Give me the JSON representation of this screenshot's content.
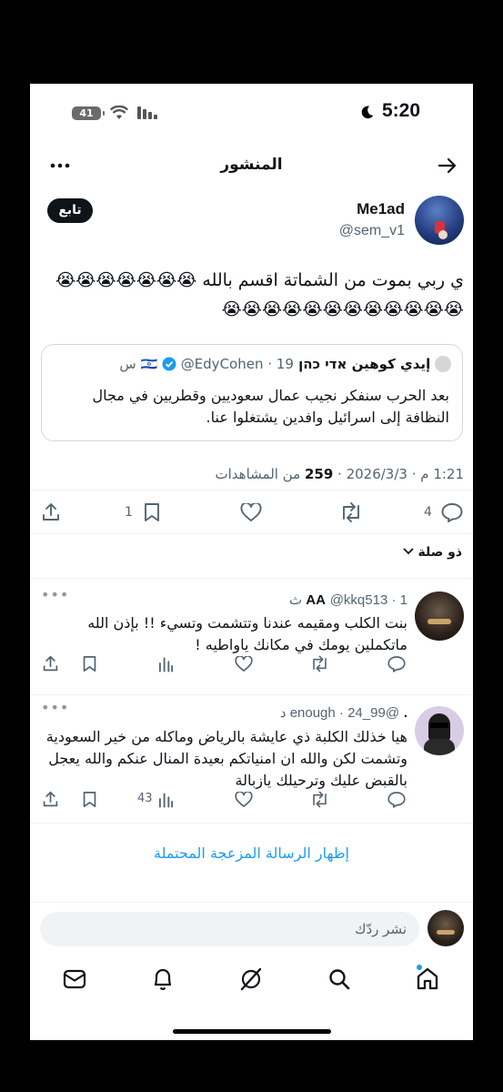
{
  "status_bar": {
    "time": "5:20",
    "battery": "41"
  },
  "header": {
    "title": "المنشور"
  },
  "post": {
    "author_name": "Me1ad",
    "author_handle": "@sem_v1",
    "follow_label": "تابع",
    "text": "ي ربي بموت من الشماتة اقسم بالله 😭😭😭😭😭😭😭😭😭😭😭😭😭😭😭😭😭😭😭",
    "quote": {
      "name": "إيدي كوهين אדי כהן 🇮🇱",
      "handle": "@EdyCohen",
      "time": "19 س",
      "text": "بعد الحرب سنفكر نجيب عمال سعوديين وقطريين في مجال النظافة إلى اسرائيل وافدين  يشتغلوا عنا."
    },
    "timestamp": "1:21 م · 2026/3/3 · ",
    "views_count": "259",
    "views_label": " من المشاهدات",
    "stats": {
      "replies": "4",
      "bookmarks": "1"
    }
  },
  "relevance_label": "ذو صلة",
  "replies": [
    {
      "name": "AA",
      "handle": "@kkq513",
      "time": "1 ث",
      "text": "بنت الكلب ومقيمه عندنا وتتشمت وتسيء !! بإذن الله ماتكملين يومك في مكانك ياواطيه !",
      "views": ""
    },
    {
      "name": ".",
      "handle": "@99_enough",
      "time": "24 د",
      "text": "هيا خذلك الكلبة ذي عايشة بالرياض وماكله من خير السعودية وتشمت لكن والله ان امنياتكم بعيدة المنال عنكم والله يعجل بالقبض عليك وترحيلك يازبالة",
      "views": "43"
    }
  ],
  "show_more": "إظهار الرسالة المزعجة المحتملة",
  "reply_placeholder": "نشر ردّك",
  "colors": {
    "accent": "#1d9bf0",
    "text": "#0f1419",
    "muted": "#536471",
    "border": "#cfd9de",
    "verified": "#1d9bf0"
  },
  "icons": [
    "back-arrow-icon",
    "more-icon",
    "reply-icon",
    "repost-icon",
    "like-icon",
    "bookmark-icon",
    "share-icon",
    "views-icon",
    "home-icon",
    "search-icon",
    "grok-icon",
    "notifications-icon",
    "messages-icon"
  ]
}
